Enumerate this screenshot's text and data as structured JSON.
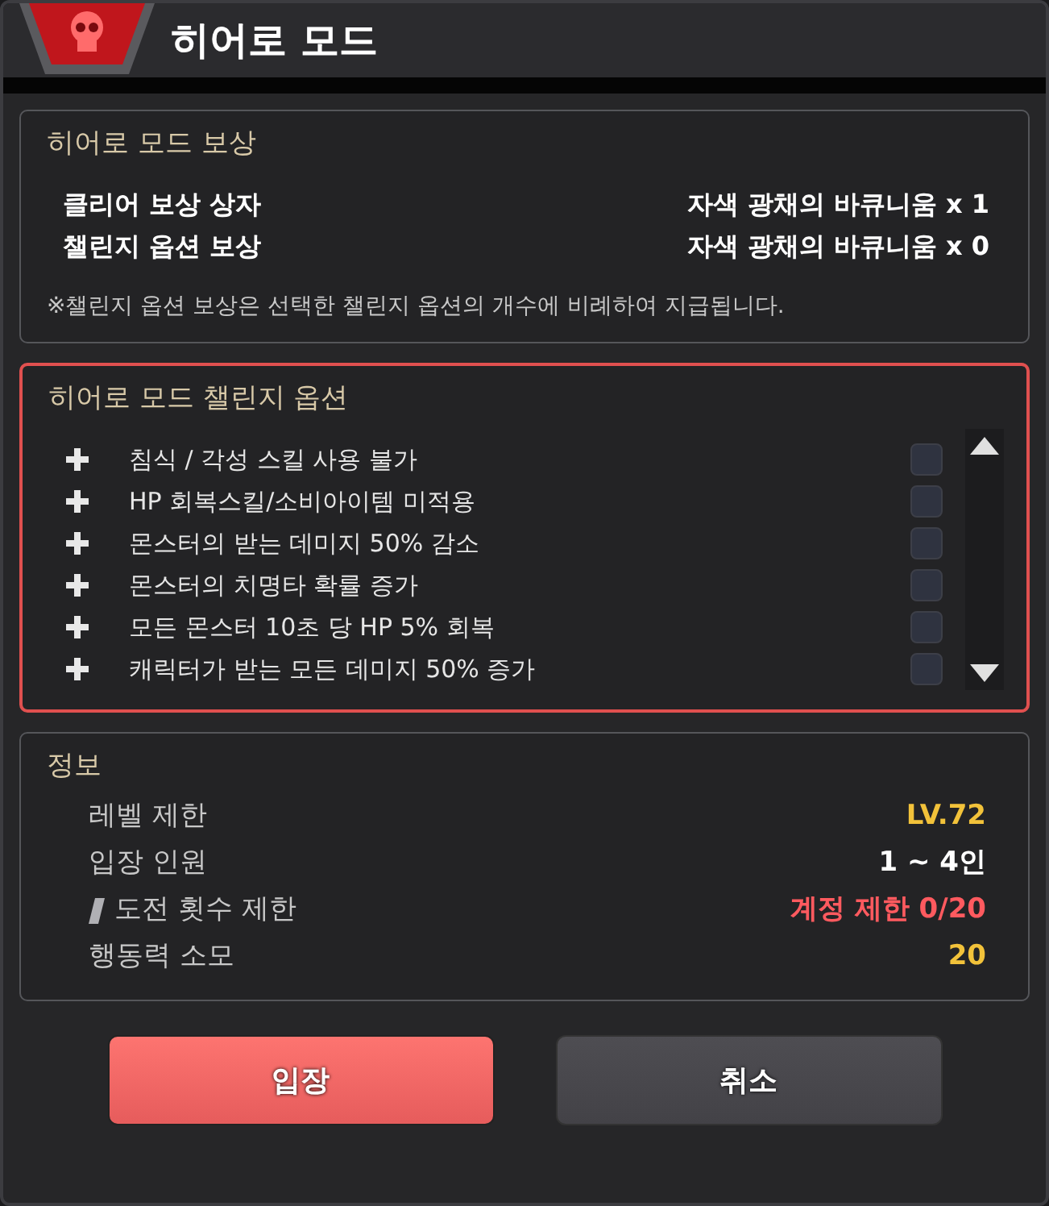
{
  "window": {
    "title": "히어로 모드"
  },
  "reward": {
    "title": "히어로 모드 보상",
    "rows": [
      {
        "label": "클리어 보상 상자",
        "value": "자색 광채의 바큐니움 x 1"
      },
      {
        "label": "챌린지 옵션 보상",
        "value": "자색 광채의 바큐니움 x 0"
      }
    ],
    "note": "※챌린지 옵션 보상은 선택한 챌린지 옵션의 개수에 비례하여 지급됩니다."
  },
  "challenge": {
    "title": "히어로 모드 챌린지 옵션",
    "highlighted": true,
    "options": [
      {
        "label": "침식 / 각성 스킬 사용 불가",
        "checked": false
      },
      {
        "label": "HP 회복스킬/소비아이템 미적용",
        "checked": false
      },
      {
        "label": "몬스터의 받는 데미지 50% 감소",
        "checked": false
      },
      {
        "label": "몬스터의 치명타 확률 증가",
        "checked": false
      },
      {
        "label": "모든 몬스터 10초 당 HP 5% 회복",
        "checked": false
      },
      {
        "label": "캐릭터가 받는 모든 데미지 50% 증가",
        "checked": false
      }
    ]
  },
  "info": {
    "title": "정보",
    "rows": [
      {
        "label": "레벨 제한",
        "value": "LV.72",
        "color": "#f2c23a",
        "kind": "plain"
      },
      {
        "label": "입장 인원",
        "value": "1 ~ 4인",
        "color": "#ffffff",
        "kind": "plain"
      },
      {
        "label": "도전 횟수 제한",
        "value": "계정 제한 0/20",
        "color": "#ff5a5f",
        "kind": "marked"
      },
      {
        "label": "행동력 소모",
        "value": "20",
        "color": "#f2c23a",
        "kind": "plain"
      }
    ]
  },
  "buttons": [
    {
      "label": "입장",
      "kind": "primary"
    },
    {
      "label": "취소",
      "kind": "secondary"
    }
  ]
}
